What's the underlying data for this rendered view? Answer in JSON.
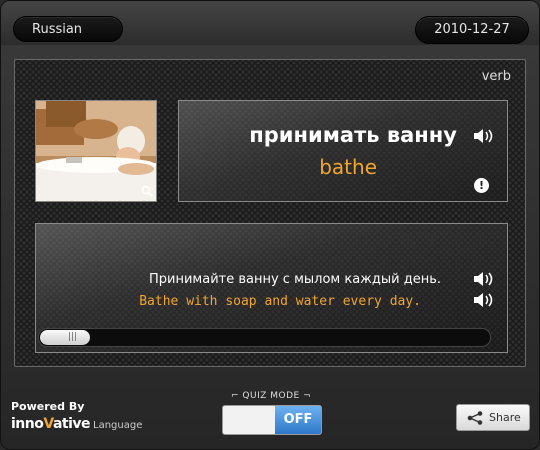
{
  "header": {
    "language": "Russian",
    "date": "2010-12-27"
  },
  "card": {
    "part_of_speech": "verb",
    "word": "принимать ванну",
    "translation": "bathe",
    "example_native": "Принимайте ванну с мылом каждый день.",
    "example_english": "Bathe with soap and water every day."
  },
  "footer": {
    "powered_by": "Powered By",
    "brand_pre": "inno",
    "brand_v": "V",
    "brand_post": "ative",
    "brand_suffix": "Language",
    "quiz_mode_label": "QUIZ MODE",
    "quiz_toggle": "OFF",
    "share_label": "Share"
  },
  "icons": {
    "speaker": "speaker-icon",
    "alert": "alert-icon",
    "zoom": "magnifier-icon",
    "share": "share-icon"
  },
  "colors": {
    "accent": "#f2a531",
    "toggle_blue": "#2e78c8"
  }
}
